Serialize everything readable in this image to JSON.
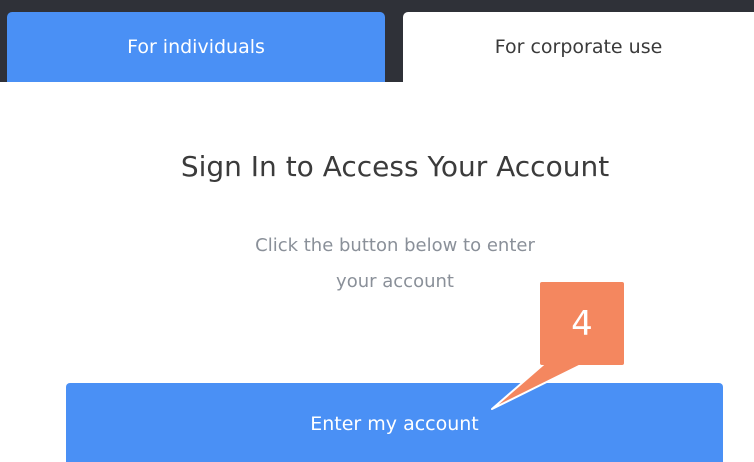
{
  "tabs": {
    "individuals": "For individuals",
    "corporate": "For corporate use"
  },
  "signin": {
    "heading": "Sign In to Access Your Account",
    "description_line1": "Click the button below to enter",
    "description_line2": "your account",
    "button_label": "Enter my account"
  },
  "callout": {
    "number": "4"
  },
  "colors": {
    "primary_blue": "#4a90f5",
    "callout_orange": "#f4875f",
    "dark_strip": "#2f3138"
  }
}
